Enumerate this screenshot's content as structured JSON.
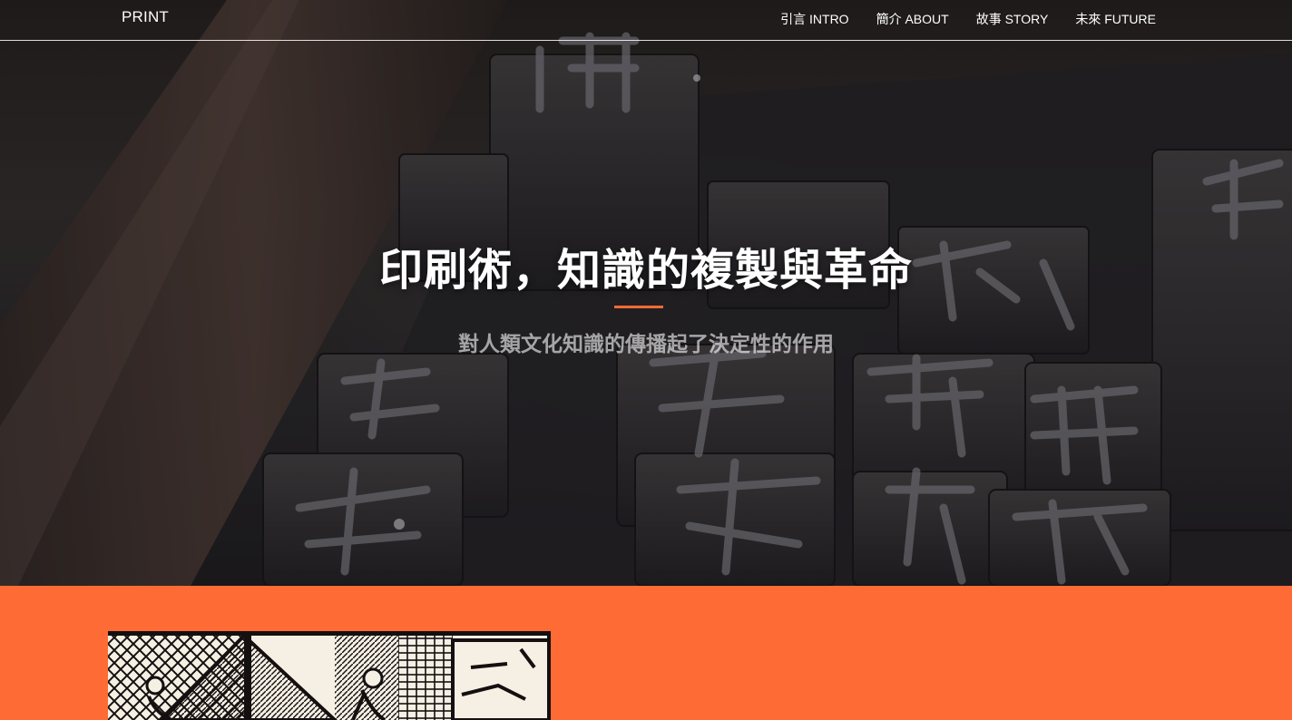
{
  "nav": {
    "brand": "PRINT",
    "links": [
      {
        "label": "引言 INTRO"
      },
      {
        "label": "簡介 ABOUT"
      },
      {
        "label": "故事 STORY"
      },
      {
        "label": "未來 FUTURE"
      }
    ]
  },
  "hero": {
    "title": "印刷術，知識的複製與革命",
    "subtitle": "對人類文化知識的傳播起了決定性的作用",
    "accent_color": "#ff6b35",
    "background": "photo-of-chinese-movable-metal-type"
  },
  "intro_section": {
    "background_color": "#ff6b35",
    "image": "woodcut-illustration-of-printing-press-workshop"
  }
}
